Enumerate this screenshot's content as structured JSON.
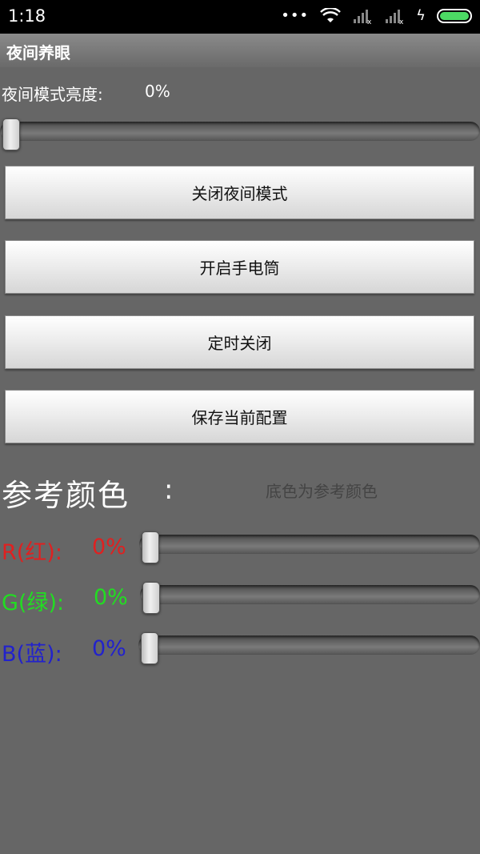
{
  "status_bar": {
    "time": "1:18",
    "more_icon": "ellipsis-icon"
  },
  "app": {
    "title": "夜间养眼"
  },
  "brightness": {
    "label": "夜间模式亮度:",
    "value": "0%",
    "level": 0
  },
  "buttons": {
    "night_mode_off": "关闭夜间模式",
    "flashlight_on": "开启手电筒",
    "timer_off": "定时关闭",
    "save_config": "保存当前配置"
  },
  "reference": {
    "title": "参考颜色",
    "colon": ":",
    "note": "底色为参考颜色"
  },
  "rgb": {
    "red": {
      "label": "R(红):",
      "value": "0%",
      "level": 0,
      "color": "#e02020"
    },
    "green": {
      "label": "G(绿):",
      "value": "0%",
      "level": 0,
      "color": "#22dd22"
    },
    "blue": {
      "label": "B(蓝):",
      "value": "0%",
      "level": 0,
      "color": "#2222cc"
    }
  },
  "colors": {
    "background": "#666666",
    "status_bar": "#000000",
    "battery": "#4cd964"
  }
}
